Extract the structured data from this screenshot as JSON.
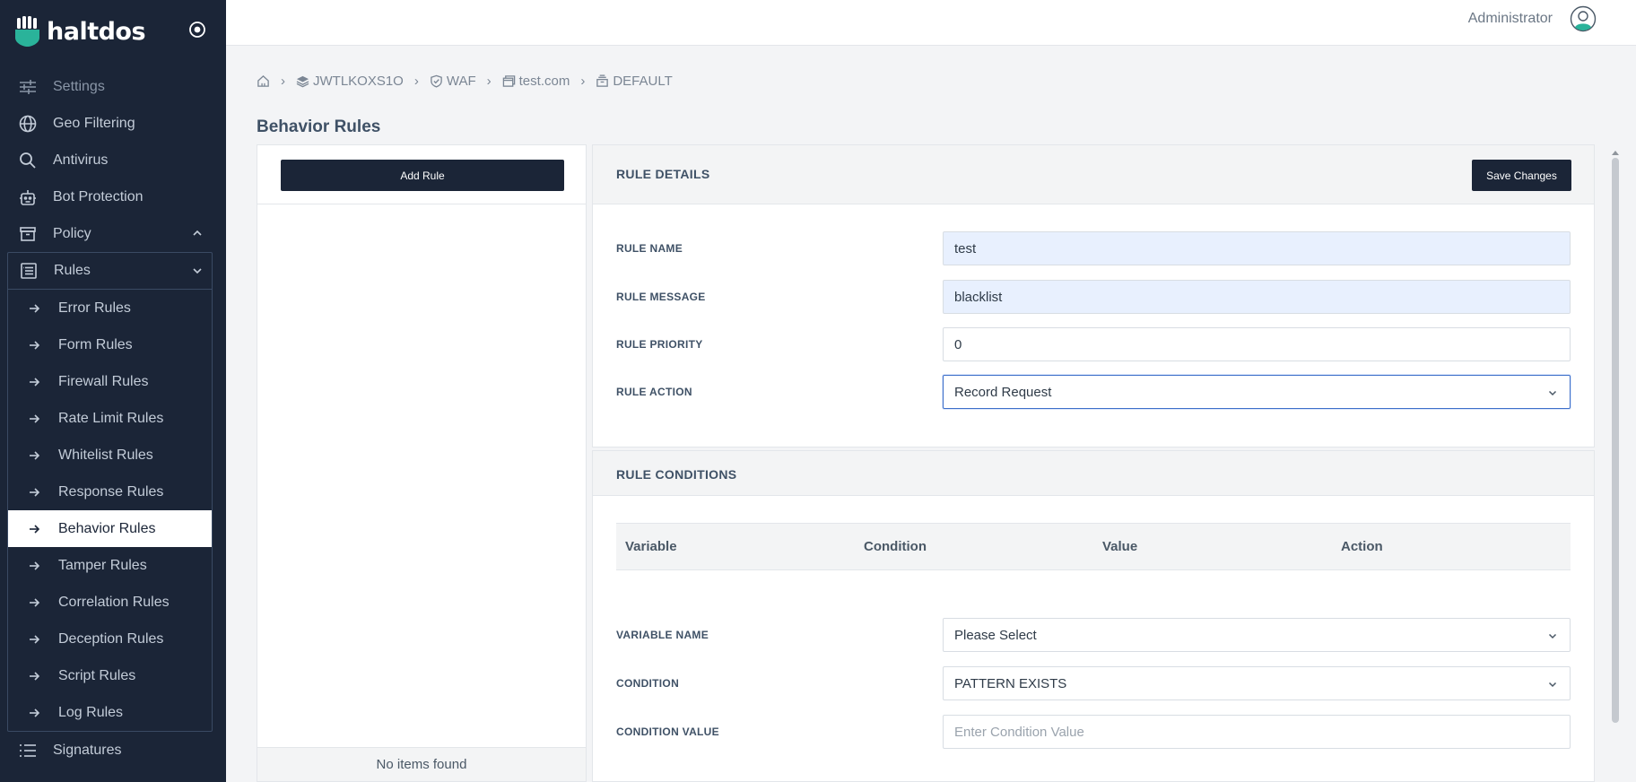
{
  "brand": {
    "name": "haltdos"
  },
  "nav": {
    "items": [
      {
        "label": "Settings",
        "icon": "sliders-icon",
        "dim": true
      },
      {
        "label": "Geo Filtering",
        "icon": "globe-icon"
      },
      {
        "label": "Antivirus",
        "icon": "search-icon"
      },
      {
        "label": "Bot Protection",
        "icon": "robot-icon"
      },
      {
        "label": "Policy",
        "icon": "archive-icon"
      }
    ],
    "rules_label": "Rules",
    "rules_sub": [
      "Error Rules",
      "Form Rules",
      "Firewall Rules",
      "Rate Limit Rules",
      "Whitelist Rules",
      "Response Rules",
      "Behavior Rules",
      "Tamper Rules",
      "Correlation Rules",
      "Deception Rules",
      "Script Rules",
      "Log Rules"
    ],
    "active_sub": "Behavior Rules",
    "signatures_label": "Signatures"
  },
  "topbar": {
    "user": "Administrator"
  },
  "breadcrumb": {
    "home_icon": "home-icon",
    "items": [
      {
        "label": "JWTLKOXS1O",
        "icon": "layers-icon"
      },
      {
        "label": "WAF",
        "icon": "shield-icon"
      },
      {
        "label": "test.com",
        "icon": "window-icon"
      },
      {
        "label": "DEFAULT",
        "icon": "stack-icon"
      }
    ]
  },
  "page": {
    "title": "Behavior Rules"
  },
  "list": {
    "add_label": "Add Rule",
    "empty_text": "No items found"
  },
  "details": {
    "title": "RULE DETAILS",
    "save_label": "Save Changes",
    "name_label": "RULE NAME",
    "name_value": "test",
    "message_label": "RULE MESSAGE",
    "message_value": "blacklist",
    "priority_label": "RULE PRIORITY",
    "priority_value": "0",
    "action_label": "RULE ACTION",
    "action_value": "Record Request"
  },
  "conditions": {
    "title": "RULE CONDITIONS",
    "columns": [
      "Variable",
      "Condition",
      "Value",
      "Action"
    ],
    "variable_label": "VARIABLE NAME",
    "variable_value": "Please Select",
    "condition_label": "CONDITION",
    "condition_value": "PATTERN EXISTS",
    "value_label": "CONDITION VALUE",
    "value_placeholder": "Enter Condition Value"
  },
  "colors": {
    "sidebar": "#1b2537",
    "accent": "#1b2537",
    "logo": "#2ab39a"
  }
}
